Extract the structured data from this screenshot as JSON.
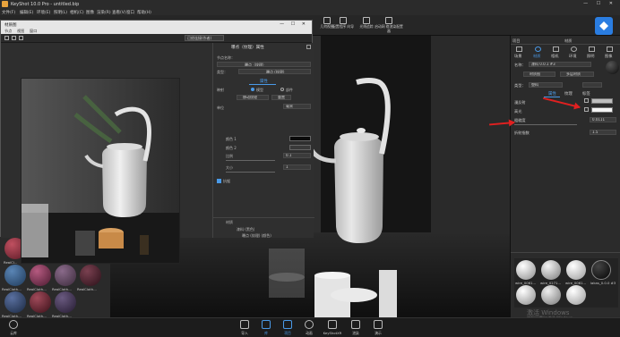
{
  "window": {
    "title": "KeyShot 10.0 Pro - untitled.bip",
    "controls": "— ☐ ✕"
  },
  "menubar": [
    "文件(F)",
    "编辑(E)",
    "环境(E)",
    "照明(L)",
    "相机(C)",
    "图像",
    "渲染(R)",
    "查看(V)",
    "窗口",
    "帮助(H)"
  ],
  "toolbar": {
    "buttons": [
      {
        "label": "几何视图"
      },
      {
        "label": "配置程序\n向导"
      },
      {
        "label": "光线追踪"
      },
      {
        "label": "启动网\n络渲染配置器"
      }
    ]
  },
  "floatwin": {
    "title": "材质图",
    "menu": [
      "节点",
      "视图",
      "窗口"
    ],
    "toolbar_label": "已经连接(作者)"
  },
  "nodepanel": {
    "header": "曝点（纹理）属性",
    "node_name_label": "节点名称：",
    "node_name_value": "曝点（纹理）",
    "type_label": "类型：",
    "type_value": "曝点 (纹理)",
    "tab_props": "属性",
    "mapping_label": "映射",
    "mode_label": "模型",
    "mode_value": "部件",
    "coord_btn": "移动纹理",
    "reset_btn": "重置",
    "unit_label": "单位",
    "unit_value": "毫米",
    "color1_label": "颜色 1",
    "color2_label": "颜色 2",
    "scale_label": "比例",
    "scale_value": "0.1",
    "size_label": "大小",
    "size_value": "1",
    "aa_label": "抗锯",
    "mat_tree_title": "材质",
    "tree": [
      "漆料 (黑色)",
      "曝点 (纹理) (颜色)"
    ]
  },
  "library": {
    "items": [
      {
        "name": "RealCl...",
        "color": "#8a2c3c"
      },
      {
        "name": "RealCloth...",
        "color": "#3a5f8a"
      },
      {
        "name": "RealCloth...",
        "color": "#8a3a5a"
      },
      {
        "name": "RealCloth...",
        "color": "#6a4a6a"
      },
      {
        "name": "RealCloth...",
        "color": "#5a3040"
      },
      {
        "name": "RealCloth...",
        "color": "#3a4f70"
      },
      {
        "name": "RealCloth...",
        "color": "#7a3040"
      },
      {
        "name": "RealCloth...",
        "color": "#4a3a5a"
      }
    ]
  },
  "rightpanel": {
    "tabs_left": "项目",
    "tabs_right": "材质",
    "tab_icons": [
      "场景",
      "材质",
      "相机",
      "环境",
      "照明",
      "图像"
    ],
    "name_label": "名称：",
    "name_value": "漆料 0.0.1 #3",
    "btn_edit": "材质图",
    "btn_multi": "多层材质",
    "type_label": "类型：",
    "type_value": "塑料",
    "subtabs": [
      "属性",
      "纹理",
      "标签"
    ],
    "fields": [
      {
        "label": "漫反射",
        "value": ""
      },
      {
        "label": "高光",
        "value": ""
      },
      {
        "label": "粗糙度",
        "value": "0.0111"
      },
      {
        "label": "折射指数",
        "value": "1.5"
      }
    ],
    "thumbs": [
      {
        "name": "wire_0061...",
        "color": "#cfcfcf"
      },
      {
        "name": "wire_0271...",
        "color": "#bdbdbd"
      },
      {
        "name": "wire_0061...",
        "color": "#e0e0e0"
      },
      {
        "name": "lakas_0.0.0 #3",
        "color": "#0d0d0d"
      }
    ],
    "watermark": "激活 Windows",
    "watermark_sub": "转到\"设置\"以激活 Windows。"
  },
  "bottombar": {
    "left_label": "云库",
    "buttons": [
      "导入",
      "库",
      "项目",
      "动画",
      "KeyShotXR",
      "渲染",
      "演示"
    ]
  }
}
